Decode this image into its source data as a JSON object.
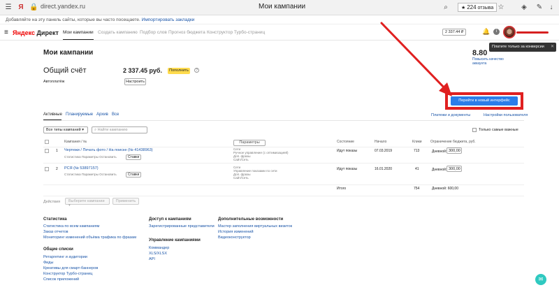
{
  "browser": {
    "url": "direct.yandex.ru",
    "tab_title": "Мои кампании",
    "rating_value": "224",
    "rating_label": "отзыва",
    "bookmarks_text": "Добавляйте на эту панель сайты, которые вы часто посещаете.",
    "bookmarks_link": "Импортировать закладки"
  },
  "header": {
    "logo_ya": "Яндекс",
    "logo_rest": " Директ",
    "nav": [
      "Мои кампании",
      "Создать кампанию",
      "Подбор слов",
      "Прогноз бюджета",
      "Конструктор Турбо-страниц"
    ],
    "balance": "2 337.44 ₽"
  },
  "tooltip": {
    "text": "Платите только за конверсии"
  },
  "main": {
    "title": "Мои кампании",
    "score": "8.80",
    "score_note": "Повысить качество аккаунта",
    "account_title": "Общий счёт",
    "account_amount": "2 337.45 руб.",
    "topup_label": "Пополнить",
    "autopay_label": "Автоплатёж",
    "autopay_button": "Настроить",
    "new_interface_button": "Перейти в новый интерфейс"
  },
  "tabs": {
    "items": [
      "Активные",
      "Планируемые",
      "Архив",
      "Все"
    ],
    "payments_link": "Платежи и документы",
    "users_link": "Настройки пользователя"
  },
  "filters": {
    "type_select": "Все типы кампаний",
    "search_placeholder": "Найти кампанию",
    "important_label": "Только самые важные"
  },
  "table": {
    "headers": [
      "Кампания / № ",
      "Параметры",
      "Состояние",
      "Начало",
      "Клики",
      "Ограничение бюджета, руб."
    ],
    "rows": [
      {
        "num": "1",
        "name": "Чертежи / Печать фото / На поиске (№ 41438963)",
        "sub": "Статистика  Параметры  Остановить",
        "mini": "Ставки",
        "params_1": "Сети",
        "params_2": "Ручное управление (с оптимизацией)",
        "params_3": "Доп. фразы",
        "params_4": "Сайт/Сеть",
        "state": "Идут показы",
        "start": "07.03.2019",
        "clicks": "713",
        "limit_label": "Дневной:",
        "limit_value": "300,00"
      },
      {
        "num": "2",
        "name": "РСЯ (№ 53897157)",
        "sub": "Статистика  Параметры  Остановить",
        "mini": "Ставки",
        "params_1": "Сети",
        "params_2": "Управление показами по сети",
        "params_3": "Доп. фразы",
        "params_4": "Сайт/Сеть",
        "state": "Идут показы",
        "start": "16.01.2020",
        "clicks": "41",
        "limit_label": "Дневной:",
        "limit_value": "300,00"
      }
    ],
    "params_button": "Параметры",
    "total_label": "Итого",
    "total_clicks": "754",
    "total_limit": "Дневной: 600,00"
  },
  "actions": {
    "label": "Действия",
    "select_button": "Выберите кампании",
    "apply_button": "Применить"
  },
  "footer": {
    "col1_head": "Статистика",
    "col1_links": [
      "Статистика по всем кампаниям",
      "Заказ отчетов",
      "Мониторинг изменений объёма трафика по фразам"
    ],
    "col1b_head": "Общие списки",
    "col1b_links": [
      "Ретаргетинг и аудитории",
      "Фиды",
      "Креативы для смарт-баннеров",
      "Конструктор Турбо-страниц",
      "Список приложений"
    ],
    "col2_head": "Доступ к кампаниям",
    "col2_links": [
      "Зарегистрированные представители"
    ],
    "col2b_head": "Управление кампаниями",
    "col2b_links": [
      "Коммандер",
      "XLS/XLSX",
      "API"
    ],
    "col3_head": "Дополнительные возможности",
    "col3_links": [
      "Мастер заполнения виртуальных визиток",
      "История изменений",
      "Видеоконструктор"
    ]
  },
  "colors": {
    "accent_blue": "#2b7de9",
    "highlight_red": "#e02020",
    "topup_yellow": "#ffdb4d"
  }
}
